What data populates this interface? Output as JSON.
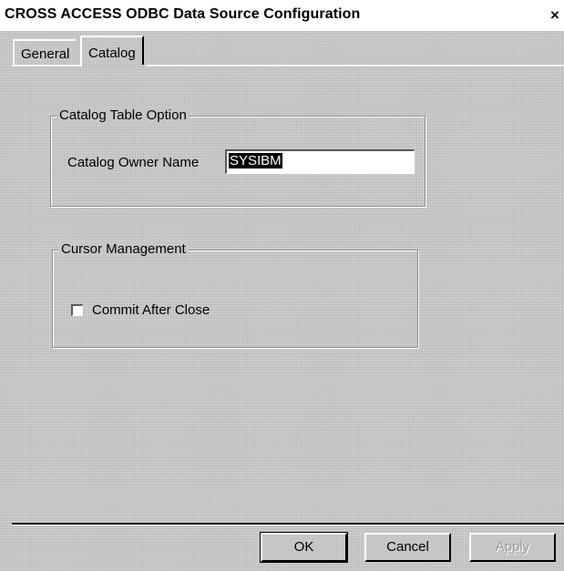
{
  "window": {
    "title": "CROSS ACCESS ODBC Data Source Configuration",
    "close_label": "×"
  },
  "tabs": [
    {
      "label": "General",
      "selected": false
    },
    {
      "label": "Catalog",
      "selected": true
    }
  ],
  "catalog_group": {
    "caption": "Catalog Table Option",
    "owner_label": "Catalog Owner Name",
    "owner_value": "SYSIBM"
  },
  "cursor_group": {
    "caption": "Cursor Management",
    "commit_label": "Commit After Close",
    "commit_checked": false
  },
  "buttons": {
    "ok": "OK",
    "cancel": "Cancel",
    "apply": "Apply"
  }
}
